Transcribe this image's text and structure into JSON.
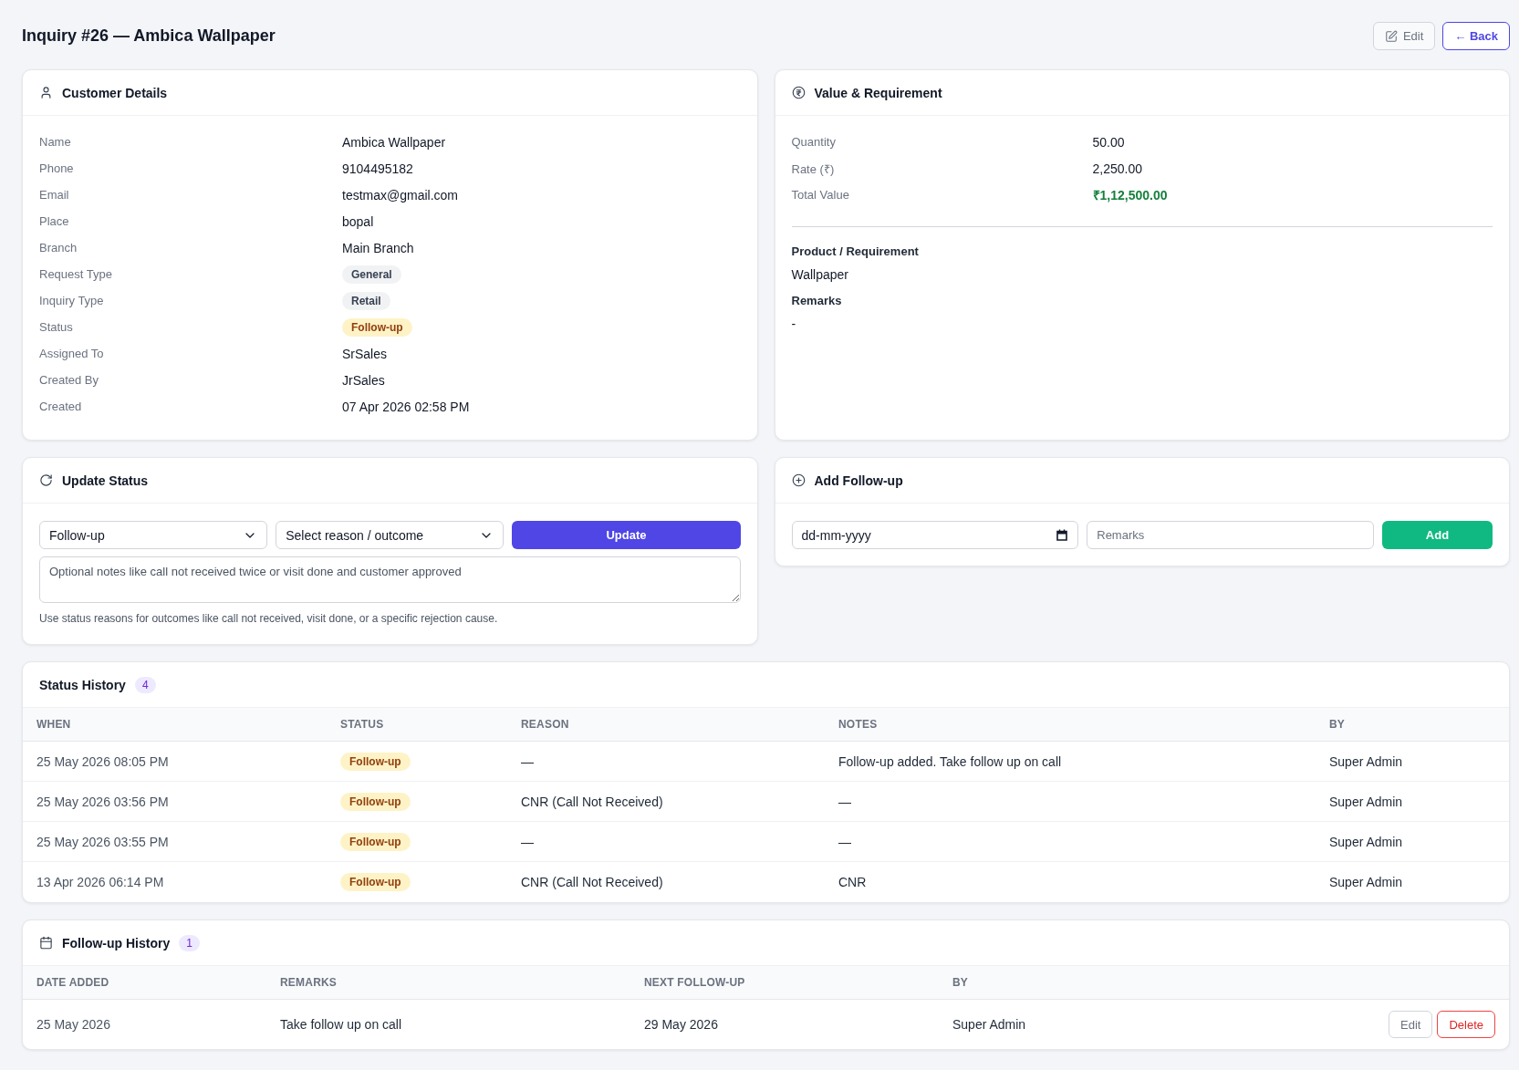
{
  "header": {
    "title": "Inquiry #26 — Ambica Wallpaper",
    "actions": [
      {
        "label": "Edit",
        "kind": "neutral"
      },
      {
        "label": "← Back",
        "kind": "accent"
      }
    ]
  },
  "customer_details": {
    "title": "Customer Details",
    "fields": [
      {
        "label": "Name",
        "value": "Ambica Wallpaper",
        "kind": "text"
      },
      {
        "label": "Phone",
        "value": "9104495182",
        "kind": "text"
      },
      {
        "label": "Email",
        "value": "testmax@gmail.com",
        "kind": "text"
      },
      {
        "label": "Place",
        "value": "bopal",
        "kind": "text"
      },
      {
        "label": "Branch",
        "value": "Main Branch",
        "kind": "text"
      },
      {
        "label": "Request Type",
        "value": "General",
        "kind": "tag"
      },
      {
        "label": "Inquiry Type",
        "value": "Retail",
        "kind": "tag"
      },
      {
        "label": "Status",
        "value": "Follow-up",
        "kind": "status"
      },
      {
        "label": "Assigned To",
        "value": "SrSales",
        "kind": "text"
      },
      {
        "label": "Created By",
        "value": "JrSales",
        "kind": "text"
      },
      {
        "label": "Created",
        "value": "07 Apr 2026 02:58 PM",
        "kind": "text"
      }
    ]
  },
  "value_requirement": {
    "title": "Value & Requirement",
    "fields": [
      {
        "label": "Quantity",
        "value": "50.00",
        "kind": "text"
      },
      {
        "label": "Rate (₹)",
        "value": "2,250.00",
        "kind": "text"
      },
      {
        "label": "Total Value",
        "value": "₹1,12,500.00",
        "kind": "total"
      }
    ],
    "notes": [
      {
        "label": "Product / Requirement",
        "value": "Wallpaper"
      },
      {
        "label": "Remarks",
        "value": "-"
      }
    ]
  },
  "update_status": {
    "title": "Update Status",
    "status_select": {
      "value": "Follow-up"
    },
    "reason_select": {
      "value": "Select reason / outcome"
    },
    "update_button": "Update",
    "notes": {
      "placeholder": "Optional notes like call not received twice or visit done and customer approved"
    },
    "hint": "Use status reasons for outcomes like call not received, visit done, or a specific rejection cause."
  },
  "add_follow_up": {
    "title": "Add Follow-up",
    "date": {
      "placeholder": "dd-mm-yyyy"
    },
    "remarks": {
      "placeholder": "Remarks"
    },
    "add_button": "Add"
  },
  "status_history": {
    "title": "Status History",
    "count": "4",
    "columns": [
      "WHEN",
      "STATUS",
      "REASON",
      "NOTES",
      "BY"
    ],
    "rows": [
      {
        "when": "25 May 2026 08:05 PM",
        "status": "Follow-up",
        "reason": "—",
        "notes": "Follow-up added. Take follow up on call",
        "by": "Super Admin"
      },
      {
        "when": "25 May 2026 03:56 PM",
        "status": "Follow-up",
        "reason": "CNR (Call Not Received)",
        "notes": "—",
        "by": "Super Admin"
      },
      {
        "when": "25 May 2026 03:55 PM",
        "status": "Follow-up",
        "reason": "—",
        "notes": "—",
        "by": "Super Admin"
      },
      {
        "when": "13 Apr 2026 06:14 PM",
        "status": "Follow-up",
        "reason": "CNR (Call Not Received)",
        "notes": "CNR",
        "by": "Super Admin"
      }
    ]
  },
  "follow_up_history": {
    "title": "Follow-up History",
    "count": "1",
    "columns": [
      "DATE ADDED",
      "REMARKS",
      "NEXT FOLLOW-UP",
      "BY"
    ],
    "rows": [
      {
        "date_added": "25 May 2026",
        "remarks": "Take follow up on call",
        "next_follow_up": "29 May 2026",
        "by": "Super Admin",
        "actions": [
          {
            "label": "Edit",
            "kind": "neutral"
          },
          {
            "label": "Delete",
            "kind": "danger"
          }
        ]
      }
    ]
  }
}
